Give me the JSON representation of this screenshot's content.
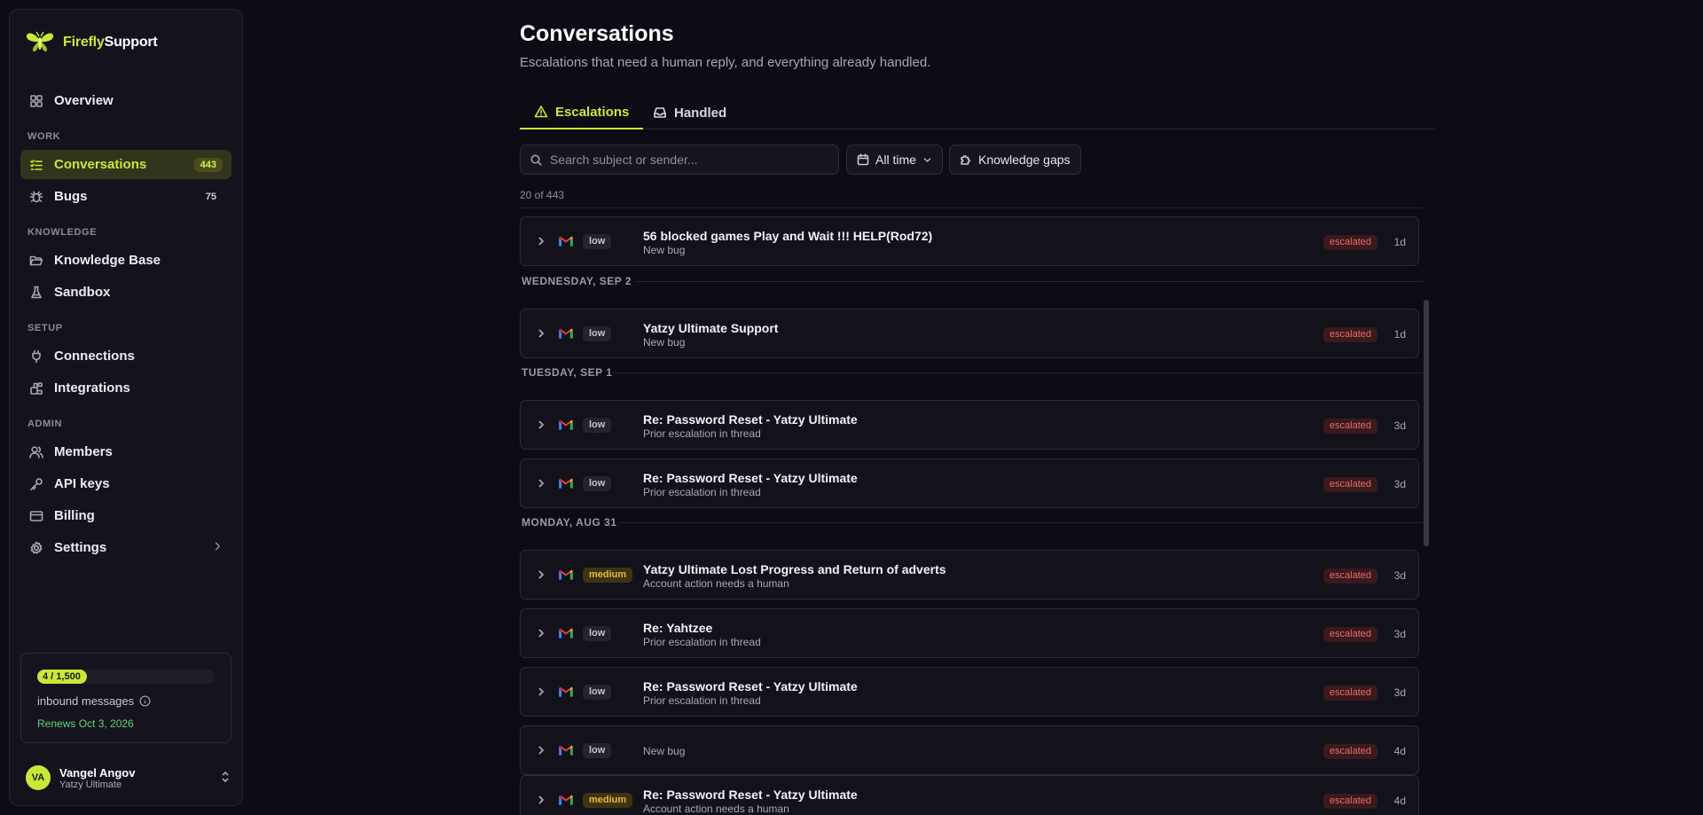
{
  "brand": {
    "name_part1": "Firefly",
    "name_part2": "Support"
  },
  "sidebar": {
    "overview": "Overview",
    "sections": {
      "work": "WORK",
      "knowledge": "KNOWLEDGE",
      "setup": "SETUP",
      "admin": "ADMIN"
    },
    "conversations": {
      "label": "Conversations",
      "count": "443"
    },
    "bugs": {
      "label": "Bugs",
      "count": "75"
    },
    "knowledge_base": "Knowledge Base",
    "sandbox": "Sandbox",
    "connections": "Connections",
    "integrations": "Integrations",
    "members": "Members",
    "api_keys": "API keys",
    "billing": "Billing",
    "settings": "Settings"
  },
  "usage": {
    "count": "4 / 1,500",
    "fraction": 0.0027,
    "label": "inbound messages",
    "renews": "Renews Oct 3, 2026"
  },
  "user": {
    "initials": "VA",
    "name": "Vangel Angov",
    "org": "Yatzy Ultimate"
  },
  "page": {
    "title": "Conversations",
    "subtitle": "Escalations that need a human reply, and everything already handled."
  },
  "tabs": {
    "escalations": "Escalations",
    "handled": "Handled"
  },
  "filters": {
    "search_placeholder": "Search subject or sender...",
    "time": "All time",
    "knowledge_gaps": "Knowledge gaps",
    "result_count": "20 of 443"
  },
  "days": {
    "d1": "WEDNESDAY, SEP 2",
    "d2": "TUESDAY, SEP 1",
    "d3": "MONDAY, AUG 31"
  },
  "rows": [
    {
      "priority": "low",
      "title": "56 blocked games Play and Wait !!! HELP(Rod72)",
      "sub": "New bug",
      "status": "escalated",
      "age": "1d"
    },
    {
      "priority": "low",
      "title": "Yatzy Ultimate Support",
      "sub": "New bug",
      "status": "escalated",
      "age": "1d"
    },
    {
      "priority": "low",
      "title": "Re: Password Reset - Yatzy Ultimate",
      "sub": "Prior escalation in thread",
      "status": "escalated",
      "age": "3d"
    },
    {
      "priority": "low",
      "title": "Re: Password Reset - Yatzy Ultimate",
      "sub": "Prior escalation in thread",
      "status": "escalated",
      "age": "3d"
    },
    {
      "priority": "medium",
      "title": "Yatzy Ultimate Lost Progress and Return of adverts",
      "sub": "Account action needs a human",
      "status": "escalated",
      "age": "3d"
    },
    {
      "priority": "low",
      "title": "Re: Yahtzee",
      "sub": "Prior escalation in thread",
      "status": "escalated",
      "age": "3d"
    },
    {
      "priority": "low",
      "title": "Re: Password Reset - Yatzy Ultimate",
      "sub": "Prior escalation in thread",
      "status": "escalated",
      "age": "3d"
    },
    {
      "priority": "low",
      "title": "",
      "sub": "New bug",
      "status": "escalated",
      "age": "4d"
    },
    {
      "priority": "medium",
      "title": "Re: Password Reset - Yatzy Ultimate",
      "sub": "Account action needs a human",
      "status": "escalated",
      "age": "4d"
    }
  ],
  "colors": {
    "accent": "#c8e83a",
    "escalated": "#e86a6a",
    "medium": "#e8b93a",
    "renew": "#5fd37a"
  }
}
